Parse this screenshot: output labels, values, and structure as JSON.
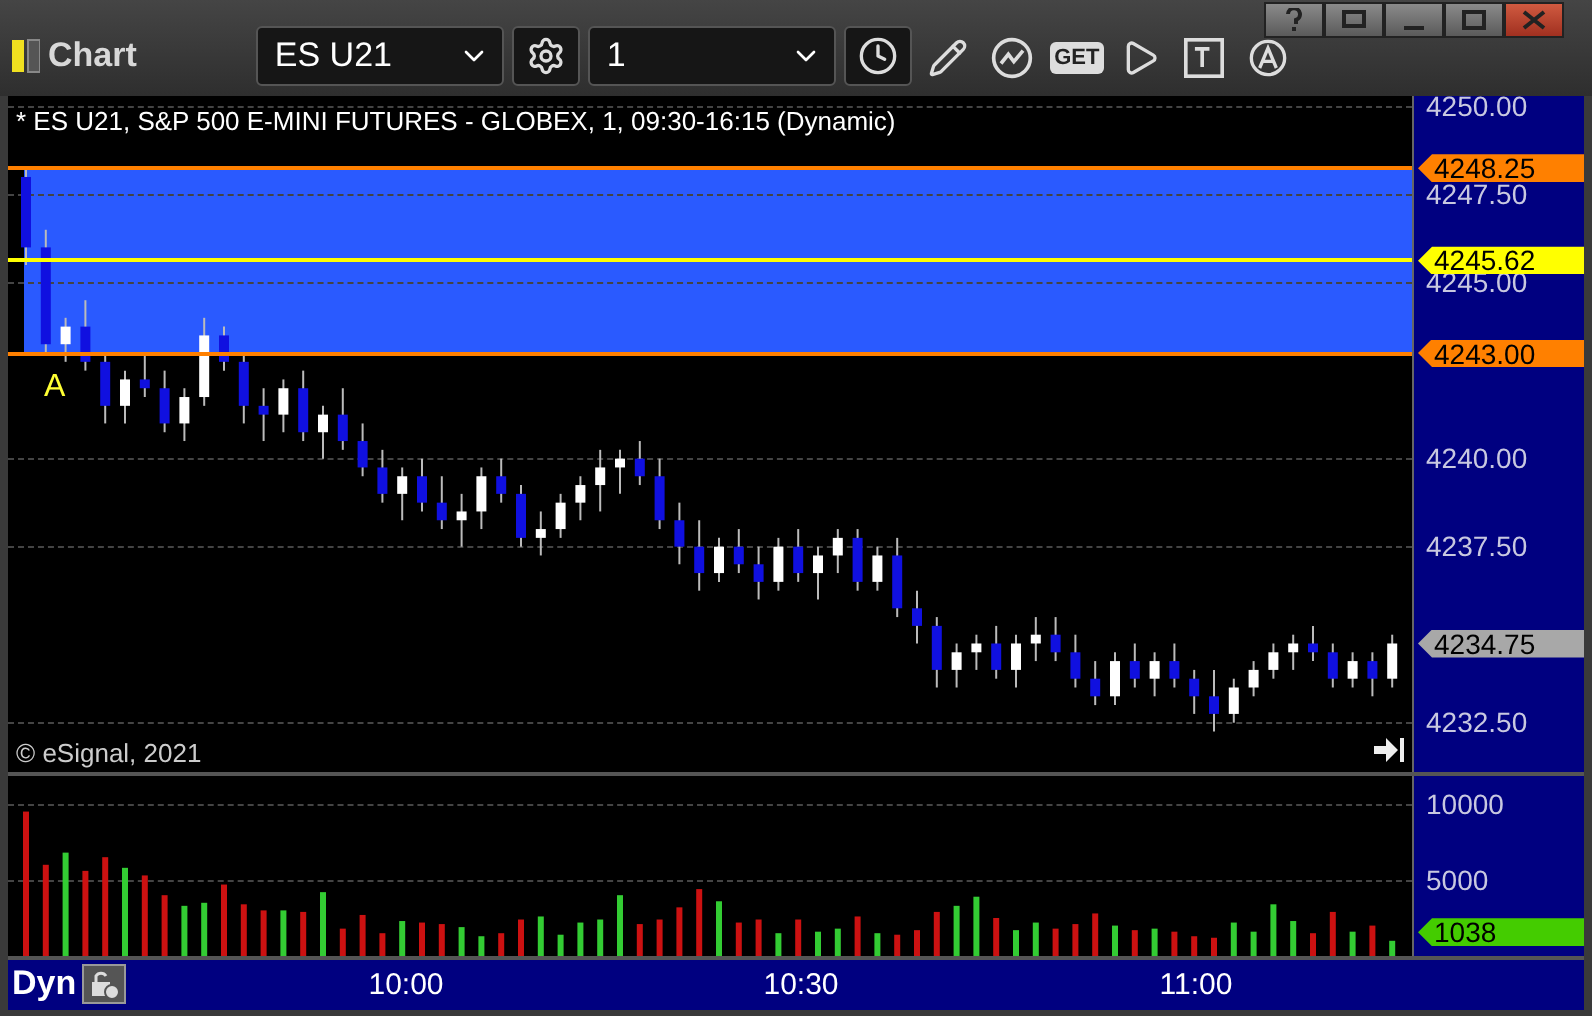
{
  "window": {
    "title": "Chart"
  },
  "toolbar": {
    "symbol": "ES U21",
    "interval": "1",
    "get_label": "GET"
  },
  "chart": {
    "header": "* ES U21, S&P 500 E-MINI FUTURES - GLOBEX, 1, 09:30-16:15 (Dynamic)",
    "alert_marker": "A",
    "copyright": "© eSignal, 2021",
    "price_markers": [
      {
        "label": "4248.25",
        "color": "#ff8000",
        "kind": "line"
      },
      {
        "label": "4245.62",
        "color": "#ffff00",
        "kind": "line"
      },
      {
        "label": "4243.00",
        "color": "#ff8000",
        "kind": "line"
      },
      {
        "label": "4234.75",
        "color": "#a8a8a8",
        "kind": "last"
      }
    ],
    "chart_data": {
      "type": "candlestick",
      "grid": true,
      "ylim": [
        4231.1,
        4250.3
      ],
      "categories": [
        null,
        null,
        null,
        null,
        null,
        null,
        null,
        null,
        null,
        null,
        null,
        null,
        null,
        null,
        null,
        null,
        null,
        null,
        null,
        null,
        null,
        null,
        null,
        null,
        null,
        null,
        null,
        null,
        null,
        null,
        null,
        null,
        null,
        null,
        null,
        null,
        null,
        null,
        null,
        null,
        null,
        null,
        null,
        null,
        null,
        null,
        null,
        null,
        null,
        null,
        null,
        null,
        null,
        null,
        null,
        null,
        null,
        null,
        null,
        null,
        null,
        null,
        null,
        null,
        null,
        null,
        null,
        null,
        null,
        null
      ],
      "yticks": [
        {
          "value": 4250,
          "label": "4250.00"
        },
        {
          "value": 4247.5,
          "label": "4247.50"
        },
        {
          "value": 4245,
          "label": "4245.00"
        },
        {
          "value": 4240,
          "label": "4240.00"
        },
        {
          "value": 4237.5,
          "label": "4237.50"
        },
        {
          "value": 4232.5,
          "label": "4232.50"
        }
      ],
      "ohlc": [
        [
          4248,
          4248.25,
          4245.5,
          4246
        ],
        [
          4246,
          4246.5,
          4243,
          4243.25
        ],
        [
          4243.25,
          4244,
          4242.75,
          4243.75
        ],
        [
          4243.75,
          4244.5,
          4242.5,
          4242.75
        ],
        [
          4242.75,
          4243,
          4241,
          4241.5
        ],
        [
          4241.5,
          4242.5,
          4241,
          4242.25
        ],
        [
          4242.25,
          4243,
          4241.75,
          4242
        ],
        [
          4242,
          4242.5,
          4240.75,
          4241
        ],
        [
          4241,
          4242,
          4240.5,
          4241.75
        ],
        [
          4241.75,
          4244,
          4241.5,
          4243.5
        ],
        [
          4243.5,
          4243.75,
          4242.5,
          4242.75
        ],
        [
          4242.75,
          4243,
          4241,
          4241.5
        ],
        [
          4241.5,
          4242,
          4240.5,
          4241.25
        ],
        [
          4241.25,
          4242.25,
          4240.75,
          4242
        ],
        [
          4242,
          4242.5,
          4240.5,
          4240.75
        ],
        [
          4240.75,
          4241.5,
          4240,
          4241.25
        ],
        [
          4241.25,
          4242,
          4240.25,
          4240.5
        ],
        [
          4240.5,
          4241,
          4239.5,
          4239.75
        ],
        [
          4239.75,
          4240.25,
          4238.75,
          4239
        ],
        [
          4239,
          4239.75,
          4238.25,
          4239.5
        ],
        [
          4239.5,
          4240,
          4238.5,
          4238.75
        ],
        [
          4238.75,
          4239.5,
          4238,
          4238.25
        ],
        [
          4238.25,
          4239,
          4237.5,
          4238.5
        ],
        [
          4238.5,
          4239.75,
          4238,
          4239.5
        ],
        [
          4239.5,
          4240,
          4238.75,
          4239
        ],
        [
          4239,
          4239.25,
          4237.5,
          4237.75
        ],
        [
          4237.75,
          4238.5,
          4237.25,
          4238
        ],
        [
          4238,
          4239,
          4237.75,
          4238.75
        ],
        [
          4238.75,
          4239.5,
          4238.25,
          4239.25
        ],
        [
          4239.25,
          4240.25,
          4238.5,
          4239.75
        ],
        [
          4239.75,
          4240.25,
          4239,
          4240
        ],
        [
          4240,
          4240.5,
          4239.25,
          4239.5
        ],
        [
          4239.5,
          4240,
          4238,
          4238.25
        ],
        [
          4238.25,
          4238.75,
          4237,
          4237.5
        ],
        [
          4237.5,
          4238.25,
          4236.25,
          4236.75
        ],
        [
          4236.75,
          4237.75,
          4236.5,
          4237.5
        ],
        [
          4237.5,
          4238,
          4236.75,
          4237
        ],
        [
          4237,
          4237.5,
          4236,
          4236.5
        ],
        [
          4236.5,
          4237.75,
          4236.25,
          4237.5
        ],
        [
          4237.5,
          4238,
          4236.5,
          4236.75
        ],
        [
          4236.75,
          4237.5,
          4236,
          4237.25
        ],
        [
          4237.25,
          4238,
          4236.75,
          4237.75
        ],
        [
          4237.75,
          4238,
          4236.25,
          4236.5
        ],
        [
          4236.5,
          4237.5,
          4236.25,
          4237.25
        ],
        [
          4237.25,
          4237.75,
          4235.5,
          4235.75
        ],
        [
          4235.75,
          4236.25,
          4234.75,
          4235.25
        ],
        [
          4235.25,
          4235.5,
          4233.5,
          4234
        ],
        [
          4234,
          4234.75,
          4233.5,
          4234.5
        ],
        [
          4234.5,
          4235,
          4234,
          4234.75
        ],
        [
          4234.75,
          4235.25,
          4233.75,
          4234
        ],
        [
          4234,
          4235,
          4233.5,
          4234.75
        ],
        [
          4234.75,
          4235.5,
          4234.25,
          4235
        ],
        [
          4235,
          4235.5,
          4234.25,
          4234.5
        ],
        [
          4234.5,
          4235,
          4233.5,
          4233.75
        ],
        [
          4233.75,
          4234.25,
          4233,
          4233.25
        ],
        [
          4233.25,
          4234.5,
          4233,
          4234.25
        ],
        [
          4234.25,
          4234.75,
          4233.5,
          4233.75
        ],
        [
          4233.75,
          4234.5,
          4233.25,
          4234.25
        ],
        [
          4234.25,
          4234.75,
          4233.5,
          4233.75
        ],
        [
          4233.75,
          4234,
          4232.75,
          4233.25
        ],
        [
          4233.25,
          4234,
          4232.25,
          4232.75
        ],
        [
          4232.75,
          4233.75,
          4232.5,
          4233.5
        ],
        [
          4233.5,
          4234.25,
          4233.25,
          4234
        ],
        [
          4234,
          4234.75,
          4233.75,
          4234.5
        ],
        [
          4234.5,
          4235,
          4234,
          4234.75
        ],
        [
          4234.75,
          4235.25,
          4234.25,
          4234.5
        ],
        [
          4234.5,
          4234.75,
          4233.5,
          4233.75
        ],
        [
          4233.75,
          4234.5,
          4233.5,
          4234.25
        ],
        [
          4234.25,
          4234.5,
          4233.25,
          4233.75
        ],
        [
          4233.75,
          4235,
          4233.5,
          4234.75
        ]
      ]
    }
  },
  "volume": {
    "last": {
      "label": "1038",
      "color": "#44cc00"
    },
    "chart_data": {
      "type": "bar",
      "grid": true,
      "ylim": [
        0,
        11840
      ],
      "categories": [
        null,
        null,
        null,
        null,
        null,
        null,
        null,
        null,
        null,
        null,
        null,
        null,
        null,
        null,
        null,
        null,
        null,
        null,
        null,
        null,
        null,
        null,
        null,
        null,
        null,
        null,
        null,
        null,
        null,
        null,
        null,
        null,
        null,
        null,
        null,
        null,
        null,
        null,
        null,
        null,
        null,
        null,
        null,
        null,
        null,
        null,
        null,
        null,
        null,
        null,
        null,
        null,
        null,
        null,
        null,
        null,
        null,
        null,
        null,
        null,
        null,
        null,
        null,
        null,
        null,
        null,
        null,
        null,
        null,
        null
      ],
      "yticks": [
        {
          "value": 10000,
          "label": "10000"
        },
        {
          "value": 5000,
          "label": "5000"
        }
      ],
      "values": [
        9500,
        6000,
        6800,
        5600,
        6500,
        5800,
        5300,
        4000,
        3300,
        3500,
        4700,
        3400,
        3000,
        3000,
        2900,
        4200,
        1800,
        2700,
        1500,
        2300,
        2200,
        2100,
        1900,
        1300,
        1500,
        2400,
        2600,
        1400,
        2200,
        2400,
        4000,
        2100,
        2400,
        3200,
        4400,
        3600,
        2200,
        2400,
        1500,
        2400,
        1600,
        1800,
        2600,
        1500,
        1400,
        1700,
        2900,
        3300,
        3900,
        2500,
        1700,
        2200,
        1800,
        2100,
        2800,
        2000,
        1700,
        1800,
        1600,
        1300,
        1200,
        2200,
        1600,
        3400,
        2300,
        1500,
        2900,
        1600,
        2000,
        1000
      ]
    }
  },
  "time_axis": {
    "mode": "Dyn",
    "labels": [
      "10:00",
      "10:30",
      "11:00"
    ]
  }
}
